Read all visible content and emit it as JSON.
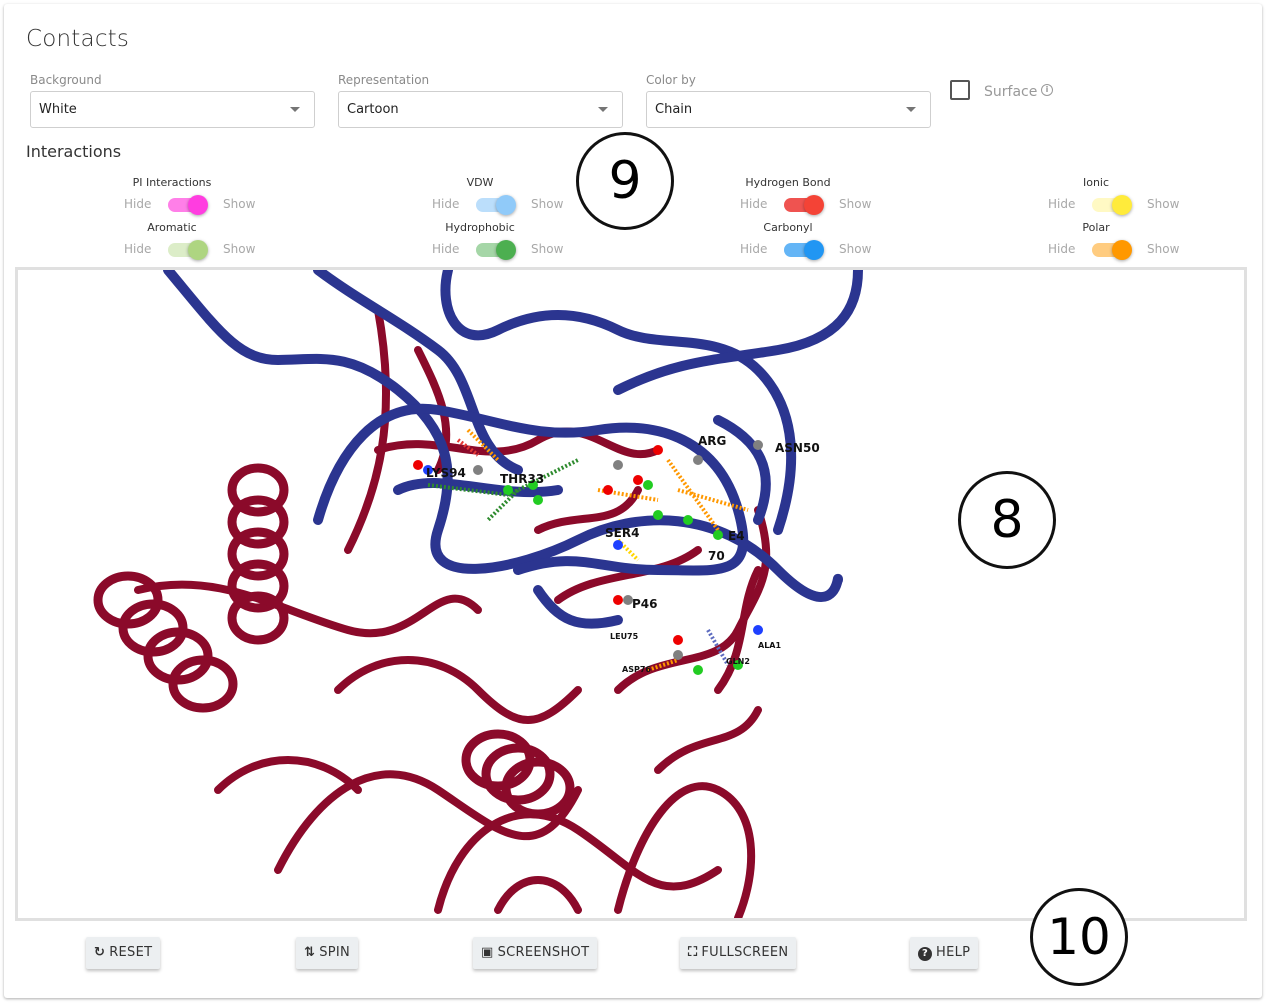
{
  "page": {
    "title": "Contacts"
  },
  "controls": {
    "background": {
      "label": "Background",
      "value": "White"
    },
    "representation": {
      "label": "Representation",
      "value": "Cartoon"
    },
    "color_by": {
      "label": "Color by",
      "value": "Chain"
    },
    "surface": {
      "label": "Surface",
      "checked": false,
      "info_icon": "info-icon"
    }
  },
  "interactions": {
    "title": "Interactions",
    "hide_label": "Hide",
    "show_label": "Show",
    "toggles": [
      {
        "name": "PI Interactions",
        "on": true,
        "color": "#ff3de0",
        "track": "#ff7fe8"
      },
      {
        "name": "VDW",
        "on": true,
        "color": "#90caf9",
        "track": "#bbdefb"
      },
      {
        "name": "Hydrogen Bond",
        "on": true,
        "color": "#f44336",
        "track": "#ef5350"
      },
      {
        "name": "Ionic",
        "on": true,
        "color": "#ffeb3b",
        "track": "#fff9c4"
      },
      {
        "name": "Aromatic",
        "on": true,
        "color": "#aed581",
        "track": "#dcedc8"
      },
      {
        "name": "Hydrophobic",
        "on": true,
        "color": "#4caf50",
        "track": "#a5d6a7"
      },
      {
        "name": "Carbonyl",
        "on": true,
        "color": "#2196f3",
        "track": "#64b5f6"
      },
      {
        "name": "Polar",
        "on": true,
        "color": "#ff9800",
        "track": "#ffcc80"
      }
    ]
  },
  "viewer": {
    "chain_colors": {
      "chain_a": "#8b0a2a",
      "chain_b": "#2b3590"
    },
    "residue_labels": [
      "LYS94",
      "THR33",
      "ARG",
      "ASN50",
      "SER4",
      "P46",
      "LEU75",
      "ASP76",
      "ALA1",
      "GLN2",
      "70",
      "E4"
    ]
  },
  "toolbar": {
    "buttons": [
      {
        "label": "RESET",
        "icon": "refresh-icon"
      },
      {
        "label": "SPIN",
        "icon": "sync-icon"
      },
      {
        "label": "SCREENSHOT",
        "icon": "camera-icon"
      },
      {
        "label": "FULLSCREEN",
        "icon": "expand-icon"
      },
      {
        "label": "HELP",
        "icon": "question-circle-icon"
      }
    ]
  },
  "callouts": [
    "9",
    "8",
    "10"
  ]
}
